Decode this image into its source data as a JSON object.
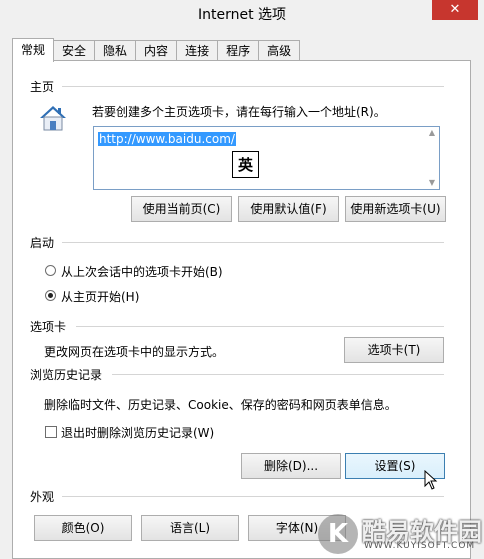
{
  "window": {
    "title": "Internet 选项",
    "close_label": "✕"
  },
  "tabs": [
    {
      "label": "常规",
      "active": true
    },
    {
      "label": "安全"
    },
    {
      "label": "隐私"
    },
    {
      "label": "内容"
    },
    {
      "label": "连接"
    },
    {
      "label": "程序"
    },
    {
      "label": "高级"
    }
  ],
  "home": {
    "section_title": "主页",
    "instruction": "若要创建多个主页选项卡，请在每行输入一个地址(R)。",
    "url_value": "http://www.baidu.com/",
    "ime_char": "英",
    "buttons": {
      "use_current": "使用当前页(C)",
      "use_default": "使用默认值(F)",
      "use_new_tab": "使用新选项卡(U)"
    }
  },
  "startup": {
    "section_title": "启动",
    "options": [
      {
        "label": "从上次会话中的选项卡开始(B)",
        "checked": false
      },
      {
        "label": "从主页开始(H)",
        "checked": true
      }
    ]
  },
  "tabs_section": {
    "section_title": "选项卡",
    "description": "更改网页在选项卡中的显示方式。",
    "button": "选项卡(T)"
  },
  "history": {
    "section_title": "浏览历史记录",
    "description": "删除临时文件、历史记录、Cookie、保存的密码和网页表单信息。",
    "checkbox_label": "退出时删除浏览历史记录(W)",
    "checkbox_checked": false,
    "delete_button": "删除(D)...",
    "settings_button": "设置(S)"
  },
  "appearance": {
    "section_title": "外观",
    "buttons": {
      "colors": "颜色(O)",
      "languages": "语言(L)",
      "fonts": "字体(N)"
    }
  },
  "watermark": {
    "logo_letter": "K",
    "text": "酷易软件园",
    "url": "WWW.KUYISOFT.COM"
  },
  "colors": {
    "close": "#c7362e",
    "selection": "#3399ff",
    "panel": "#ffffff"
  }
}
